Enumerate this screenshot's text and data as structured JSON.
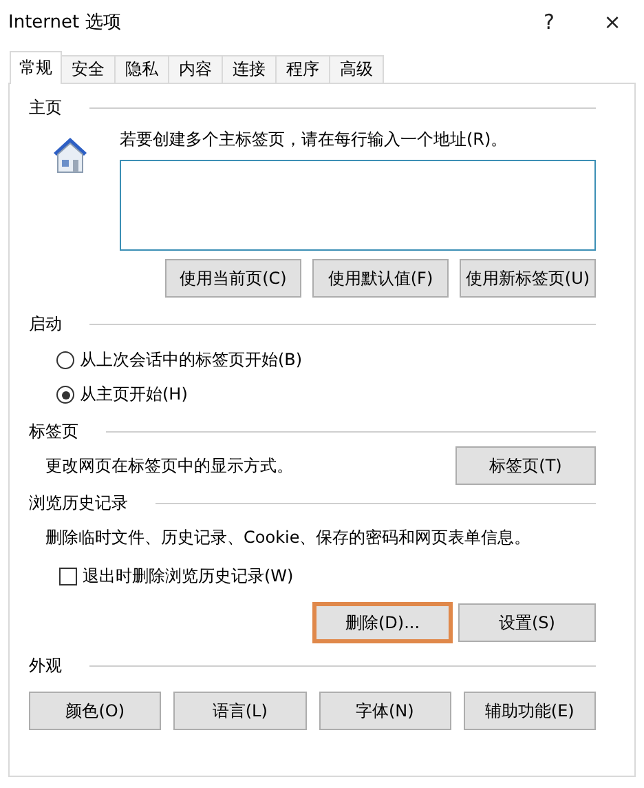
{
  "window": {
    "title": "Internet 选项",
    "help": "?",
    "close": "×"
  },
  "tabs": [
    {
      "label": "常规",
      "selected": true
    },
    {
      "label": "安全",
      "selected": false
    },
    {
      "label": "隐私",
      "selected": false
    },
    {
      "label": "内容",
      "selected": false
    },
    {
      "label": "连接",
      "selected": false
    },
    {
      "label": "程序",
      "selected": false
    },
    {
      "label": "高级",
      "selected": false
    }
  ],
  "home": {
    "heading": "主页",
    "description": "若要创建多个主标签页，请在每行输入一个地址(R)。",
    "buttons": [
      {
        "label": "使用当前页(C)",
        "focused": false
      },
      {
        "label": "使用默认值(F)",
        "focused": false
      },
      {
        "label": "使用新标签页(U)",
        "focused": false
      }
    ]
  },
  "startup": {
    "heading": "启动",
    "options": [
      {
        "label": "从上次会话中的标签页开始(B)",
        "selected": false
      },
      {
        "label": "从主页开始(H)",
        "selected": true
      }
    ]
  },
  "tabs_section": {
    "heading": "标签页",
    "description": "更改网页在标签页中的显示方式。",
    "buttons": [
      {
        "label": "标签页(T)",
        "focused": false
      }
    ]
  },
  "history": {
    "heading": "浏览历史记录",
    "description": "删除临时文件、历史记录、Cookie、保存的密码和网页表单信息。",
    "checkbox": {
      "label": "退出时删除浏览历史记录(W)",
      "checked": false
    },
    "buttons": [
      {
        "label": "删除(D)...",
        "focused": true
      },
      {
        "label": "设置(S)",
        "focused": false
      }
    ]
  },
  "appearance": {
    "heading": "外观",
    "buttons": [
      {
        "label": "颜色(O)",
        "focused": false
      },
      {
        "label": "语言(L)",
        "focused": false
      },
      {
        "label": "字体(N)",
        "focused": false
      },
      {
        "label": "辅助功能(E)",
        "focused": false
      }
    ]
  }
}
